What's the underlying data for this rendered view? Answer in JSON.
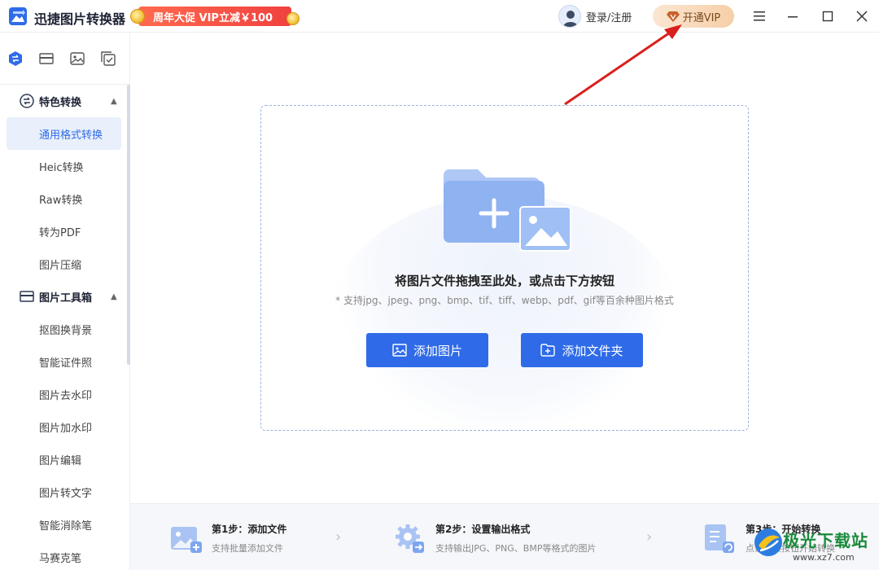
{
  "app": {
    "title": "迅捷图片转换器",
    "promo": "周年大促 VIP立减￥100",
    "login": "登录/注册",
    "vip": "开通VIP"
  },
  "sidebar": {
    "tool_icons": [
      "convert-icon",
      "toolbox-icon",
      "image-icon",
      "batch-icon"
    ],
    "groups": [
      {
        "label": "特色转换",
        "items": [
          "通用格式转换",
          "Heic转换",
          "Raw转换",
          "转为PDF",
          "图片压缩"
        ]
      },
      {
        "label": "图片工具箱",
        "items": [
          "抠图换背景",
          "智能证件照",
          "图片去水印",
          "图片加水印",
          "图片编辑",
          "图片转文字",
          "智能消除笔",
          "马赛克笔"
        ]
      }
    ],
    "active_item": "通用格式转换"
  },
  "dropzone": {
    "title": "将图片文件拖拽至此处，或点击下方按钮",
    "hint": "* 支持jpg、jpeg、png、bmp、tif、tiff、webp、pdf、gif等百余种图片格式",
    "add_image": "添加图片",
    "add_folder": "添加文件夹"
  },
  "steps": [
    {
      "title": "第1步：添加文件",
      "desc": "支持批量添加文件"
    },
    {
      "title": "第2步：设置输出格式",
      "desc": "支持输出JPG、PNG、BMP等格式的图片"
    },
    {
      "title": "第3步：开始转换",
      "desc": "点击转换按钮开始转换"
    }
  ],
  "watermark": {
    "text": "极光下载站",
    "url": "www.xz7.com"
  },
  "colors": {
    "accent": "#2f6be8",
    "promo": "#f0413f",
    "annotation_arrow": "#d9201e"
  }
}
